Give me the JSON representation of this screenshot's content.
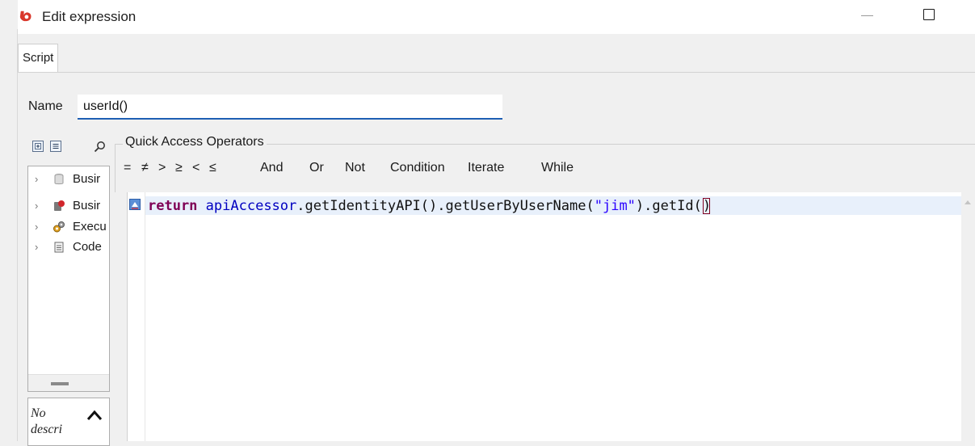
{
  "window": {
    "title": "Edit expression",
    "app_icon": "bonita-logo-icon",
    "controls": [
      "minimize-icon",
      "maximize-icon"
    ]
  },
  "tabs": [
    {
      "label": "Script",
      "selected": true
    }
  ],
  "name_field": {
    "label": "Name",
    "value": "userId()"
  },
  "tree_toolbar": {
    "icons": [
      "expand-all-icon",
      "collapse-all-icon",
      "search-icon"
    ]
  },
  "tree": {
    "items": [
      {
        "label": "Business Data Model",
        "icon": "database-icon",
        "visible_text": "Busir"
      },
      {
        "label": "Business Objects",
        "icon": "business-object-icon",
        "visible_text": "Busir"
      },
      {
        "label": "Execution Context",
        "icon": "gears-icon",
        "visible_text": "Execu"
      },
      {
        "label": "Code Templates",
        "icon": "document-icon",
        "visible_text": "Code"
      }
    ]
  },
  "description_panel": {
    "text": "No descri",
    "collapse_icon": "chevron-up-icon"
  },
  "quick_access": {
    "title": "Quick Access Operators",
    "operators": [
      "=",
      "≠",
      ">",
      "≥",
      "<",
      "≤",
      "And",
      "Or",
      "Not",
      "Condition",
      "Iterate",
      "While"
    ]
  },
  "editor": {
    "code": {
      "keyword": "return",
      "identifier": "apiAccessor",
      "chain1": ".getIdentityAPI().getUserByUserName(",
      "string": "\"jim\"",
      "chain2": ").getId(",
      "closing": ")"
    },
    "marker_icon": "quick-fix-marker-icon"
  },
  "colors": {
    "accent": "#1e5fb3",
    "keyword": "#7f0055",
    "identifier": "#0000c0",
    "string": "#2a00ff",
    "current_line": "#e8f0fb",
    "app_icon": "#d9372b"
  }
}
